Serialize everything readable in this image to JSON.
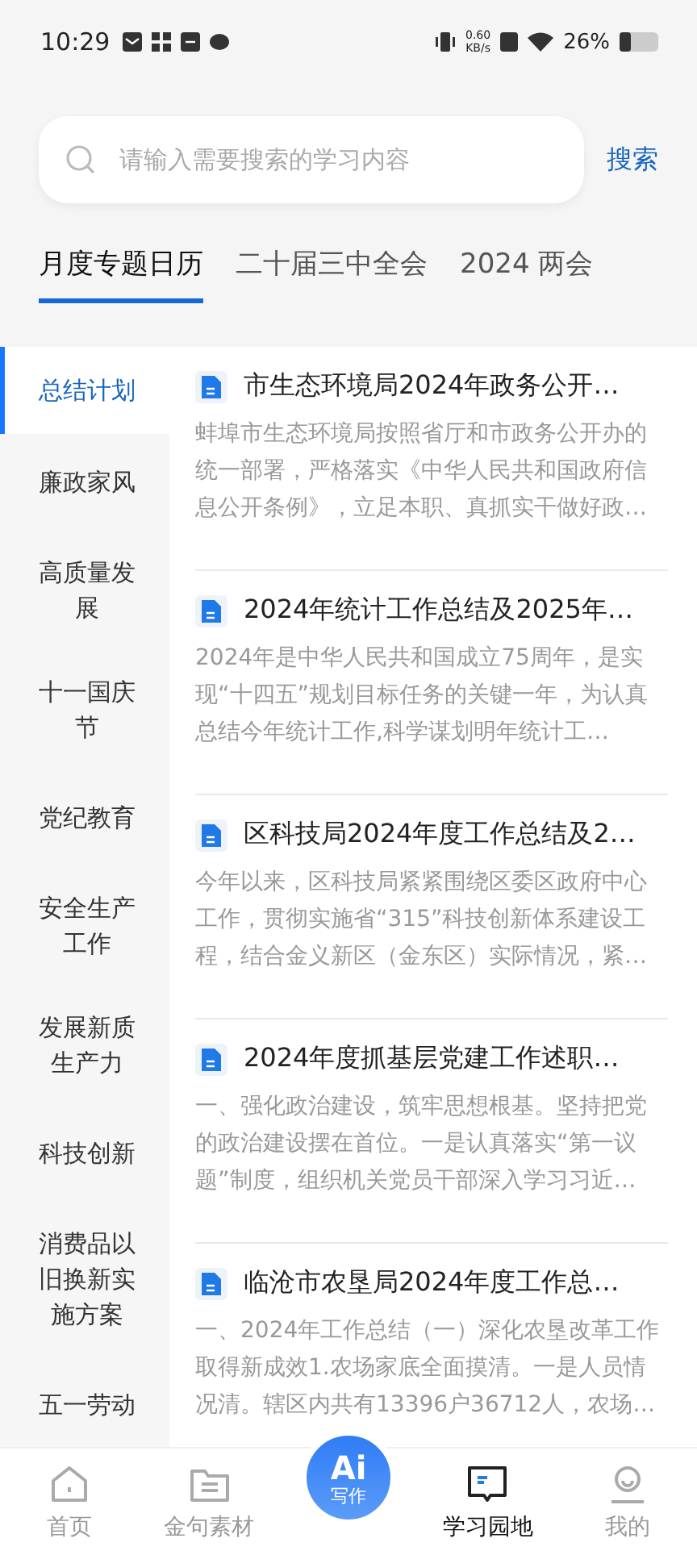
{
  "status_bar": {
    "time": "10:29",
    "speed": "0.60",
    "speed_unit": "KB/s",
    "battery": "26%"
  },
  "search": {
    "placeholder": "请输入需要搜索的学习内容",
    "button": "搜索"
  },
  "tabs": [
    {
      "label": "月度专题日历",
      "selected": true
    },
    {
      "label": "二十届三中全会",
      "selected": false
    },
    {
      "label": "2024 两会",
      "selected": false
    }
  ],
  "sidebar": {
    "items": [
      {
        "label": "总结计划",
        "selected": true
      },
      {
        "label": "廉政家风",
        "selected": false
      },
      {
        "label": "高质量发展",
        "selected": false
      },
      {
        "label": "十一国庆节",
        "selected": false
      },
      {
        "label": "党纪教育",
        "selected": false
      },
      {
        "label": "安全生产工作",
        "selected": false
      },
      {
        "label": "发展新质生产力",
        "selected": false
      },
      {
        "label": "科技创新",
        "selected": false
      },
      {
        "label": "消费品以旧换新实施方案",
        "selected": false
      },
      {
        "label": "五一劳动",
        "selected": false
      }
    ]
  },
  "articles": [
    {
      "title": "市生态环境局2024年政务公开…",
      "summary": "蚌埠市生态环境局按照省厅和市政务公开办的统一部署，严格落实《中华人民共和国政府信息公开条例》，立足本职、真抓实干做好政…"
    },
    {
      "title": "2024年统计工作总结及2025年…",
      "summary": "2024年是中华人民共和国成立75周年，是实现“十四五”规划目标任务的关键一年，为认真总结今年统计工作,科学谋划明年统计工…"
    },
    {
      "title": "区科技局2024年度工作总结及2…",
      "summary": "今年以来，区科技局紧紧围绕区委区政府中心工作，贯彻实施省“315”科技创新体系建设工程，结合金义新区（金东区）实际情况，紧…"
    },
    {
      "title": "2024年度抓基层党建工作述职…",
      "summary": "一、强化政治建设，筑牢思想根基。坚持把党的政治建设摆在首位。一是认真落实“第一议题”制度，组织机关党员干部深入学习习近…"
    },
    {
      "title": "临沧市农垦局2024年度工作总…",
      "summary": "一、2024年工作总结（一）深化农垦改革工作取得新成效1.农场家底全面摸清。一是人员情况清。辖区内共有13396户36712人，农场…"
    }
  ],
  "nav": {
    "items": [
      {
        "kind": "home",
        "label": "首页",
        "selected": false
      },
      {
        "kind": "folder",
        "label": "金句素材",
        "selected": false
      },
      {
        "kind": "ai",
        "logo": "Ai",
        "label": "写作",
        "selected": false
      },
      {
        "kind": "book",
        "label": "学习园地",
        "selected": true
      },
      {
        "kind": "user",
        "label": "我的",
        "selected": false
      }
    ]
  }
}
